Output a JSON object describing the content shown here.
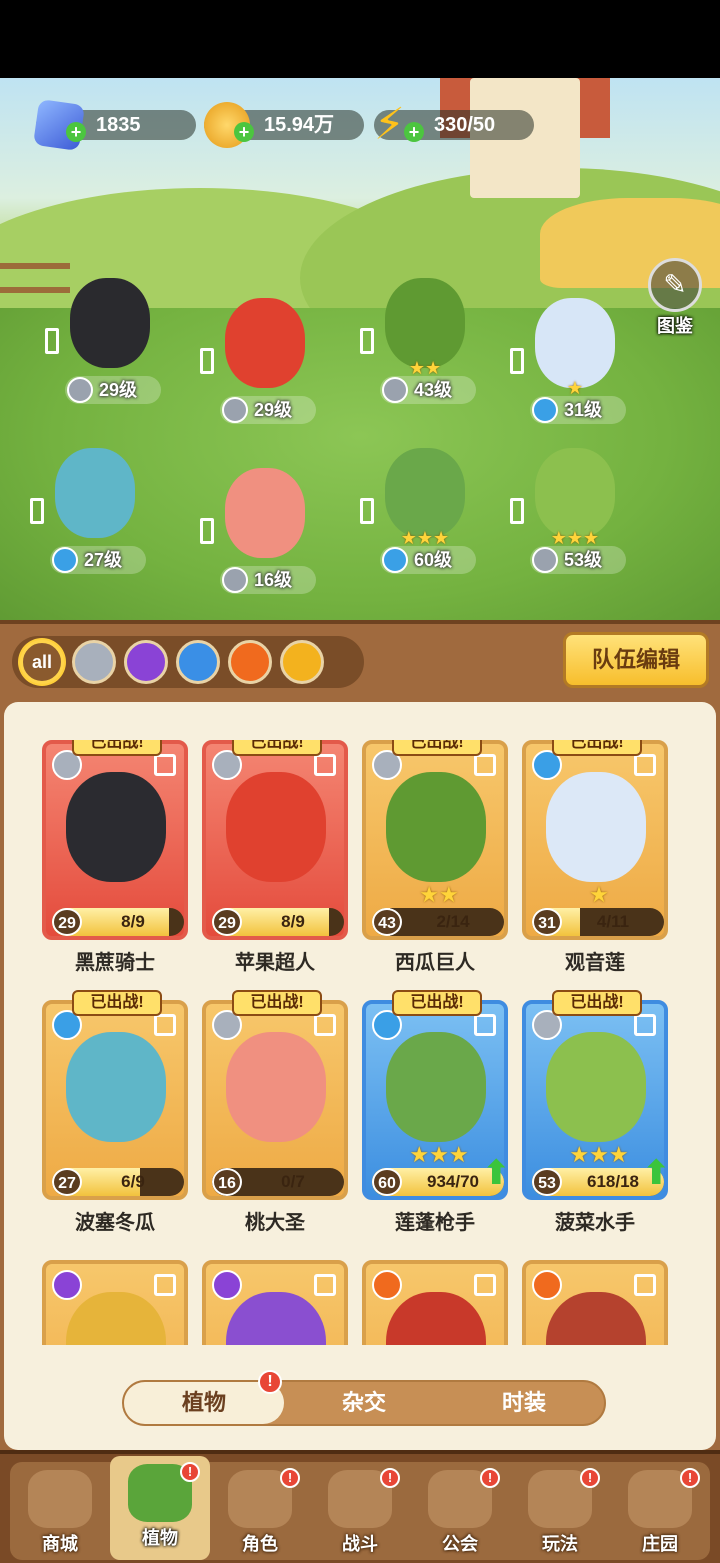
{
  "resources": {
    "gems": "1835",
    "coins": "15.94万",
    "energy": "330/50"
  },
  "codex_label": "图鉴",
  "field_plants": [
    {
      "level": "29级",
      "element": "blade-icon",
      "color": "#2a2a2e",
      "stars": ""
    },
    {
      "level": "29级",
      "element": "blade-icon",
      "color": "#e0412f",
      "stars": ""
    },
    {
      "level": "43级",
      "element": "blade-icon",
      "color": "#5f9a32",
      "stars": "★★"
    },
    {
      "level": "31级",
      "element": "water-icon",
      "color": "#d7e6f7",
      "stars": "★"
    },
    {
      "level": "27级",
      "element": "water-icon",
      "color": "#5fb6c8",
      "stars": ""
    },
    {
      "level": "16级",
      "element": "blade-icon",
      "color": "#f09080",
      "stars": ""
    },
    {
      "level": "60级",
      "element": "water-icon",
      "color": "#6aa84a",
      "stars": "★★★"
    },
    {
      "level": "53级",
      "element": "blade-icon",
      "color": "#8cc04e",
      "stars": "★★★"
    }
  ],
  "filters": [
    "all",
    "blade",
    "potion",
    "water",
    "fire",
    "thunder"
  ],
  "filter_all_label": "all",
  "team_edit_label": "队伍编辑",
  "deployed_label": "已出战!",
  "cards": [
    {
      "name": "黑蔗骑士",
      "level": "29",
      "fragments": "8/9",
      "progress": 0.89,
      "stars": "",
      "element": "blade",
      "frame": "red",
      "color": "#2b2b30",
      "deployed": true,
      "upgrade": false
    },
    {
      "name": "苹果超人",
      "level": "29",
      "fragments": "8/9",
      "progress": 0.89,
      "stars": "",
      "element": "blade",
      "frame": "red",
      "color": "#e0412f",
      "deployed": true,
      "upgrade": false
    },
    {
      "name": "西瓜巨人",
      "level": "43",
      "fragments": "2/14",
      "progress": 0.14,
      "stars": "★★",
      "element": "blade",
      "frame": "gold",
      "color": "#5f9a32",
      "deployed": true,
      "upgrade": false
    },
    {
      "name": "观音莲",
      "level": "31",
      "fragments": "4/11",
      "progress": 0.36,
      "stars": "★",
      "element": "water",
      "frame": "gold",
      "color": "#dce8f7",
      "deployed": true,
      "upgrade": false
    },
    {
      "name": "波塞冬瓜",
      "level": "27",
      "fragments": "6/9",
      "progress": 0.67,
      "stars": "",
      "element": "water",
      "frame": "gold",
      "color": "#5fb6c8",
      "deployed": true,
      "upgrade": false
    },
    {
      "name": "桃大圣",
      "level": "16",
      "fragments": "0/7",
      "progress": 0.0,
      "stars": "",
      "element": "blade",
      "frame": "gold",
      "color": "#f09080",
      "deployed": true,
      "upgrade": false
    },
    {
      "name": "莲蓬枪手",
      "level": "60",
      "fragments": "934/70",
      "progress": 1.0,
      "stars": "★★★",
      "element": "water",
      "frame": "blue",
      "color": "#6aa84a",
      "deployed": true,
      "upgrade": true
    },
    {
      "name": "菠菜水手",
      "level": "53",
      "fragments": "618/18",
      "progress": 1.0,
      "stars": "★★★",
      "element": "blade",
      "frame": "blue",
      "color": "#8cc04e",
      "deployed": true,
      "upgrade": true
    },
    {
      "name": "",
      "level": "",
      "fragments": "",
      "progress": 0,
      "stars": "",
      "element": "potion",
      "frame": "gold",
      "color": "#e6b43a",
      "deployed": false,
      "upgrade": false
    },
    {
      "name": "",
      "level": "",
      "fragments": "",
      "progress": 0,
      "stars": "",
      "element": "potion",
      "frame": "gold",
      "color": "#8a4fd0",
      "deployed": false,
      "upgrade": false
    },
    {
      "name": "",
      "level": "",
      "fragments": "",
      "progress": 0,
      "stars": "",
      "element": "fire",
      "frame": "gold",
      "color": "#c8392a",
      "deployed": false,
      "upgrade": false
    },
    {
      "name": "",
      "level": "",
      "fragments": "",
      "progress": 0,
      "stars": "",
      "element": "fire",
      "frame": "gold",
      "color": "#b5422e",
      "deployed": false,
      "upgrade": false
    }
  ],
  "segment": {
    "plants": "植物",
    "hybrid": "杂交",
    "fashion": "时装",
    "alert": "!"
  },
  "nav": [
    {
      "label": "商城",
      "icon": "shop-icon",
      "badge": false,
      "active": false
    },
    {
      "label": "植物",
      "icon": "plants-icon",
      "badge": true,
      "active": true
    },
    {
      "label": "角色",
      "icon": "character-icon",
      "badge": true,
      "active": false
    },
    {
      "label": "战斗",
      "icon": "battle-icon",
      "badge": true,
      "active": false
    },
    {
      "label": "公会",
      "icon": "guild-icon",
      "badge": true,
      "active": false
    },
    {
      "label": "玩法",
      "icon": "gameplay-icon",
      "badge": true,
      "active": false
    },
    {
      "label": "庄园",
      "icon": "manor-icon",
      "badge": true,
      "active": false
    }
  ],
  "nav_badge": "!"
}
